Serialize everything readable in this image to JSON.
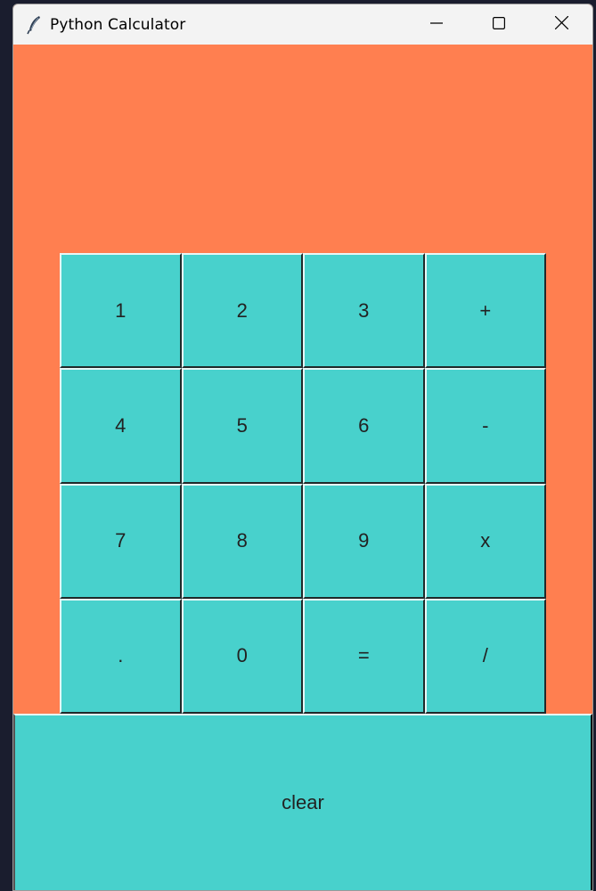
{
  "window": {
    "title": "Python Calculator",
    "icon": "feather-icon",
    "background_color": "#ff7f50",
    "controls": {
      "minimize_icon": "minimize-icon",
      "maximize_icon": "maximize-icon",
      "close_icon": "close-icon"
    }
  },
  "display": {
    "value": ""
  },
  "keypad": {
    "button_color": "#48d1cc",
    "keys": [
      "1",
      "2",
      "3",
      "+",
      "4",
      "5",
      "6",
      "-",
      "7",
      "8",
      "9",
      "x",
      ".",
      "0",
      "=",
      "/"
    ]
  },
  "clear_button": {
    "label": "clear"
  }
}
